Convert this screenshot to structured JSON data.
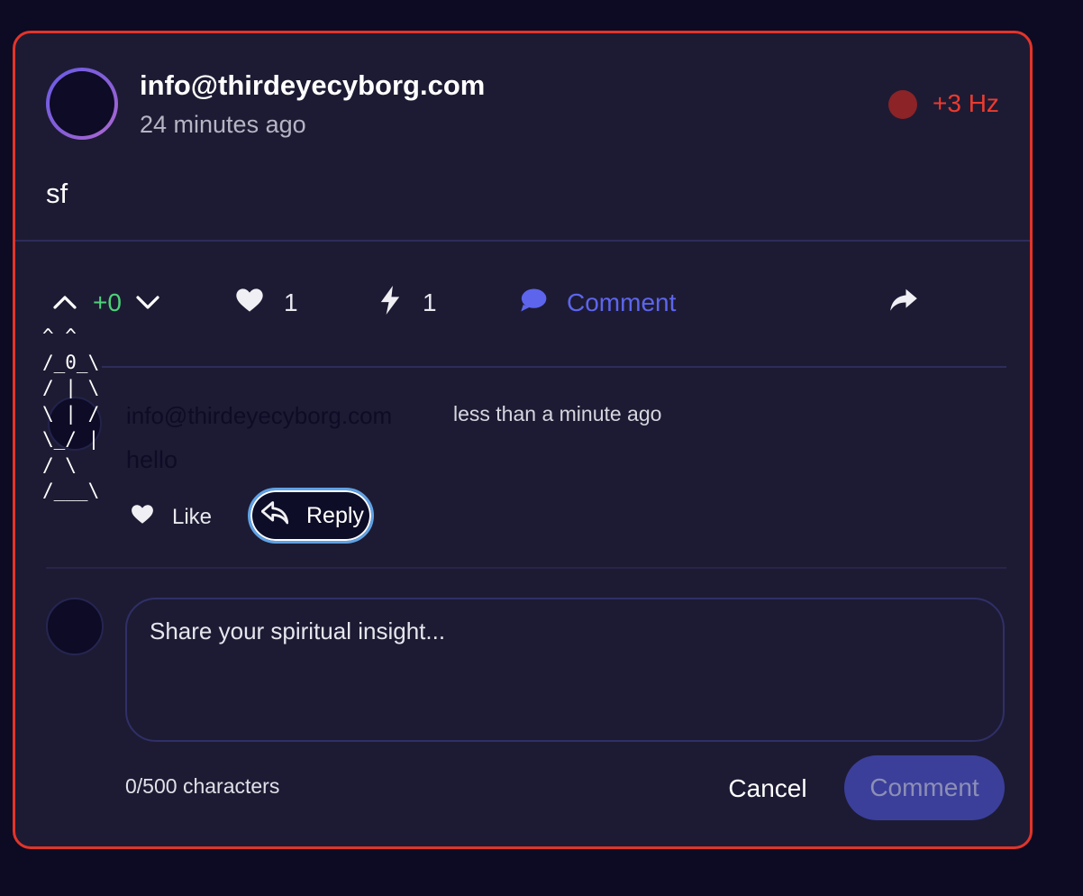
{
  "post": {
    "author": "info@thirdeyecyborg.com",
    "time": "24 minutes ago",
    "frequency": "+3 Hz",
    "body": "sf"
  },
  "actions": {
    "vote_score": "+0",
    "like_count": "1",
    "energy_count": "1",
    "comment_label": "Comment"
  },
  "ascii_art": "^ ^\n/_0_\\\n/ | \\\n\\ | /\n\\_/ |\n/ \\\n/___\\",
  "reply": {
    "author": "info@thirdeyecyborg.com",
    "time": "less than a minute ago",
    "text": "hello",
    "like_label": "Like",
    "reply_label": "Reply"
  },
  "composer": {
    "placeholder": "Share your spiritual insight...",
    "char_count": "0/500 characters",
    "cancel_label": "Cancel",
    "submit_label": "Comment"
  },
  "colors": {
    "card_border": "#e2342a",
    "score_green": "#4ed17a",
    "comment_accent": "#5d65ed",
    "frequency_red": "#ec3a2f"
  }
}
